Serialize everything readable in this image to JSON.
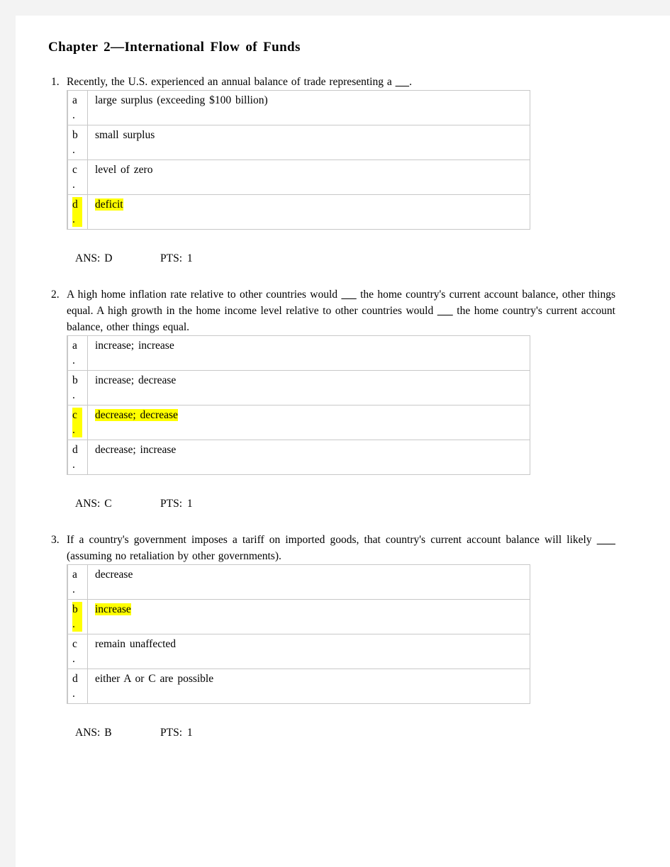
{
  "document": {
    "title": "Chapter 2—International Flow of Funds",
    "highlight_color": "#ffff00",
    "page_background": "#ffffff",
    "canvas_background": "#f3f3f3"
  },
  "questions": [
    {
      "number": "1.",
      "text": "Recently, the U.S. experienced an annual balance of trade representing a ____.",
      "options": [
        {
          "letter": "a",
          "dot": ".",
          "text": "large surplus (exceeding $100 billion)",
          "highlighted": false
        },
        {
          "letter": "b",
          "dot": ".",
          "text": "small surplus",
          "highlighted": false
        },
        {
          "letter": "c",
          "dot": ".",
          "text": "level of zero",
          "highlighted": false
        },
        {
          "letter": "d",
          "dot": ".",
          "text": "deficit",
          "highlighted": true
        }
      ],
      "answer": "ANS: D",
      "points": "PTS:  1"
    },
    {
      "number": "2.",
      "text": "A high home inflation rate relative to other countries would ____ the home country's current account balance, other things equal. A high growth in the home income level relative to other countries would ____ the home country's current account balance, other things equal.",
      "options": [
        {
          "letter": "a",
          "dot": ".",
          "text": "increase; increase",
          "highlighted": false
        },
        {
          "letter": "b",
          "dot": ".",
          "text": "increase; decrease",
          "highlighted": false
        },
        {
          "letter": "c",
          "dot": ".",
          "text": "decrease; decrease",
          "highlighted": true
        },
        {
          "letter": "d",
          "dot": ".",
          "text": "decrease; increase",
          "highlighted": false
        }
      ],
      "answer": "ANS: C",
      "points": "PTS:  1"
    },
    {
      "number": "3.",
      "text": "If a country's government imposes a tariff on imported goods, that country's current account balance will likely ____ (assuming no retaliation by other governments).",
      "options": [
        {
          "letter": "a",
          "dot": ".",
          "text": "decrease",
          "highlighted": false
        },
        {
          "letter": "b",
          "dot": ".",
          "text": "increase",
          "highlighted": true
        },
        {
          "letter": "c",
          "dot": ".",
          "text": "remain unaffected",
          "highlighted": false
        },
        {
          "letter": "d",
          "dot": ".",
          "text": "either A or C are possible",
          "highlighted": false
        }
      ],
      "answer": "ANS: B",
      "points": "PTS:  1"
    }
  ]
}
